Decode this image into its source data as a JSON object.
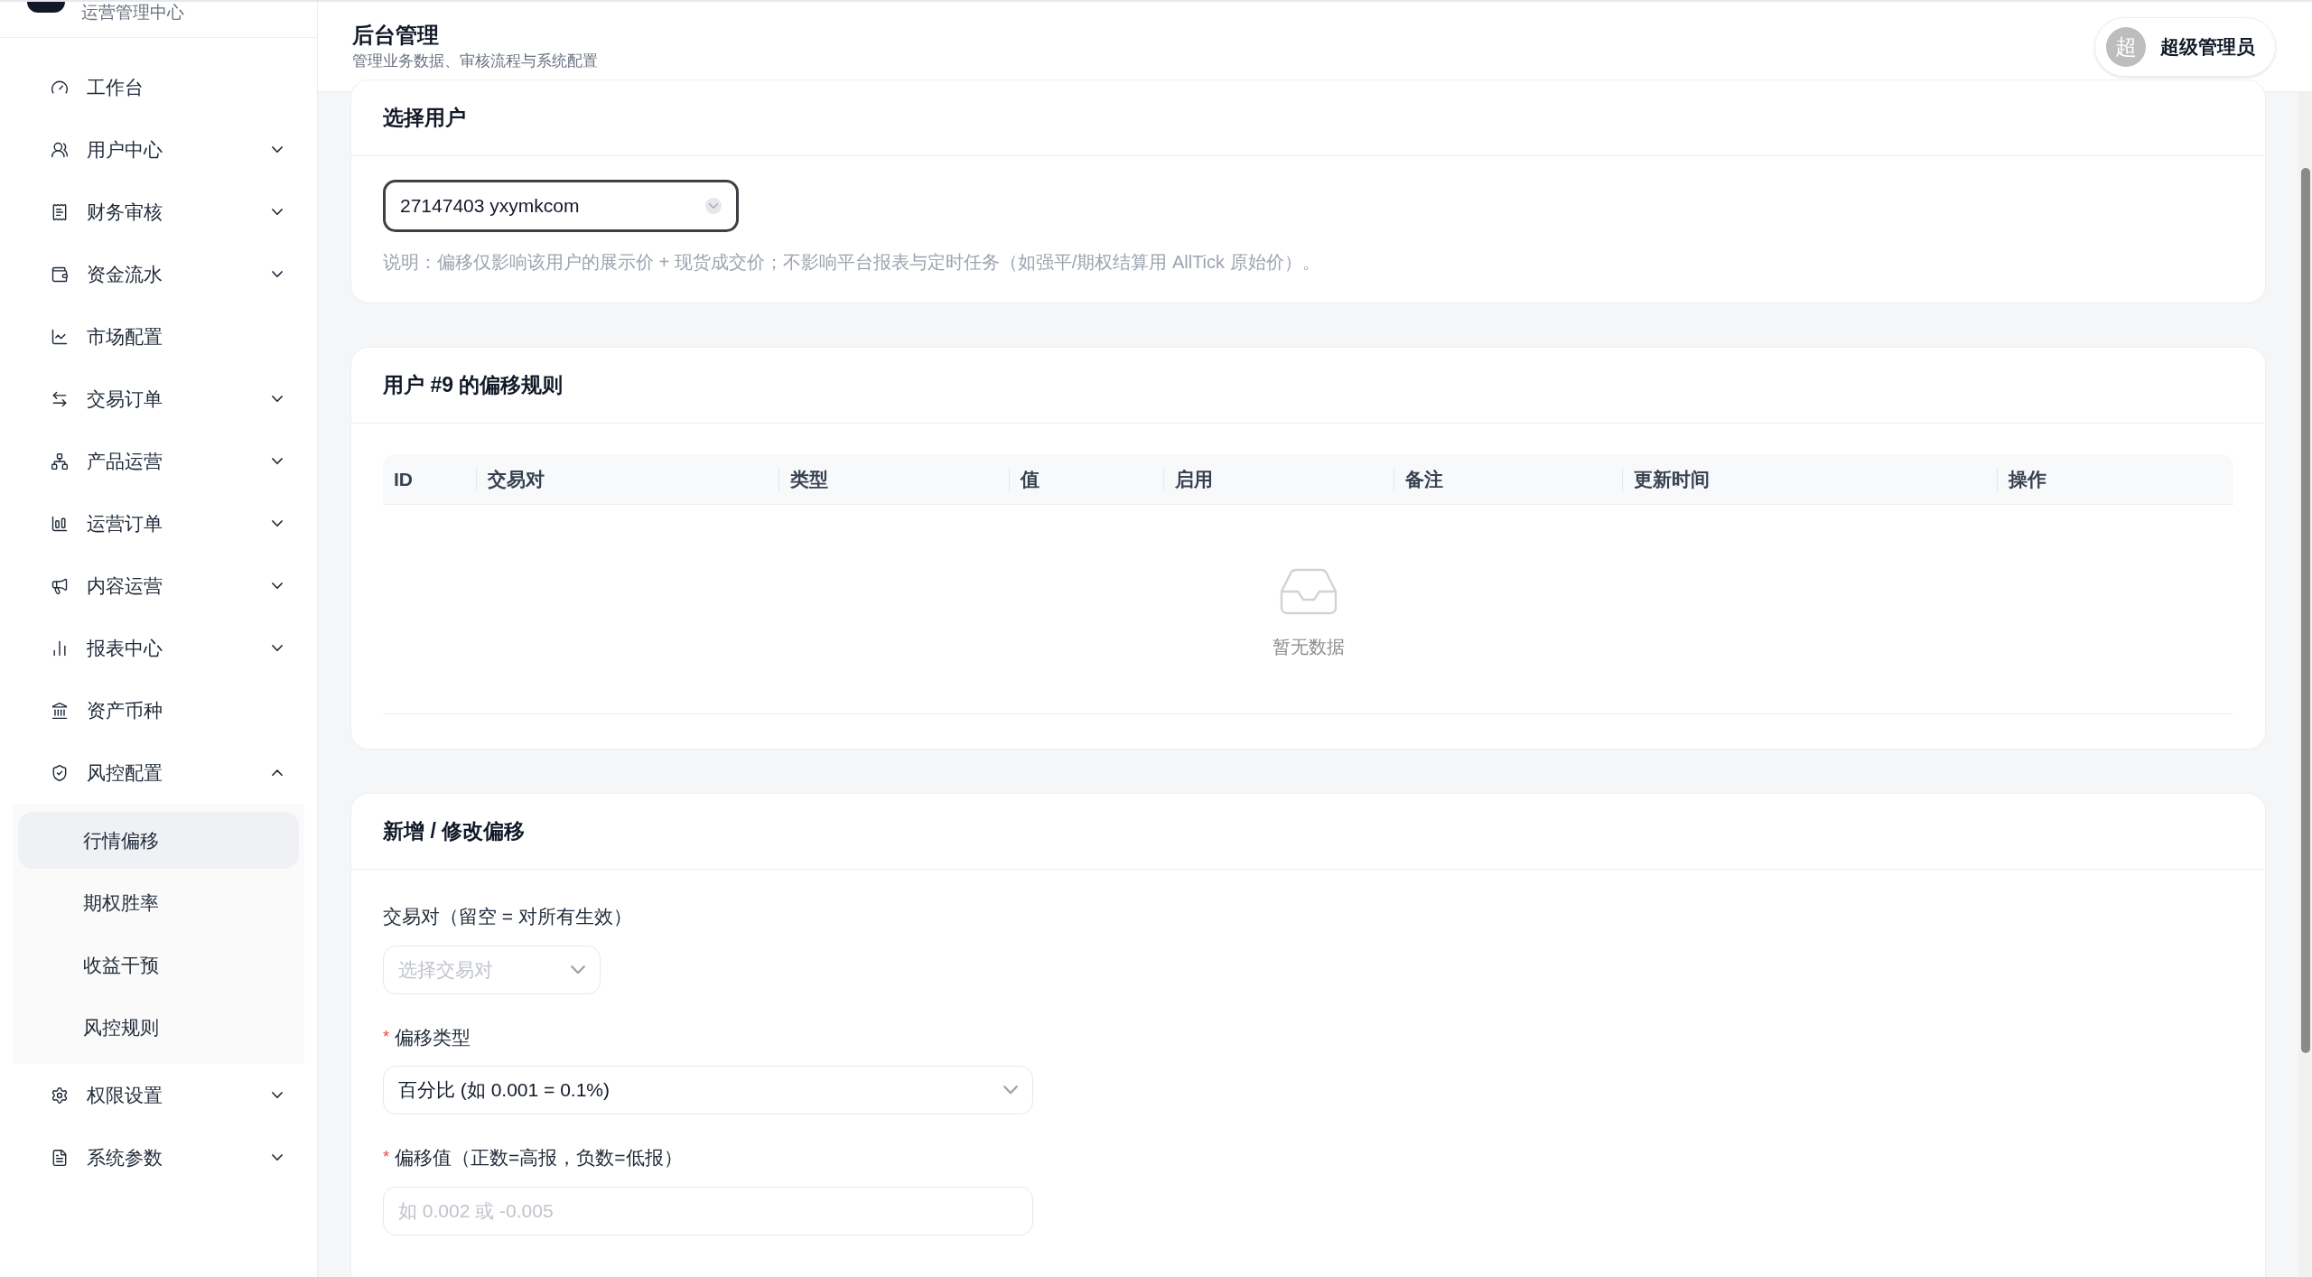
{
  "sidebar": {
    "subtitle": "运营管理中心",
    "items": [
      {
        "label": "工作台",
        "kind": "link"
      },
      {
        "label": "用户中心",
        "kind": "group",
        "expanded": false
      },
      {
        "label": "财务审核",
        "kind": "group",
        "expanded": false
      },
      {
        "label": "资金流水",
        "kind": "group",
        "expanded": false
      },
      {
        "label": "市场配置",
        "kind": "link"
      },
      {
        "label": "交易订单",
        "kind": "group",
        "expanded": false
      },
      {
        "label": "产品运营",
        "kind": "group",
        "expanded": false
      },
      {
        "label": "运营订单",
        "kind": "group",
        "expanded": false
      },
      {
        "label": "内容运营",
        "kind": "group",
        "expanded": false
      },
      {
        "label": "报表中心",
        "kind": "group",
        "expanded": false
      },
      {
        "label": "资产币种",
        "kind": "link"
      },
      {
        "label": "风控配置",
        "kind": "group",
        "expanded": true,
        "children": [
          {
            "label": "行情偏移",
            "selected": true
          },
          {
            "label": "期权胜率",
            "selected": false
          },
          {
            "label": "收益干预",
            "selected": false
          },
          {
            "label": "风控规则",
            "selected": false
          }
        ]
      },
      {
        "label": "权限设置",
        "kind": "group",
        "expanded": false
      },
      {
        "label": "系统参数",
        "kind": "group",
        "expanded": false
      }
    ]
  },
  "header": {
    "title": "后台管理",
    "subtitle": "管理业务数据、审核流程与系统配置",
    "user": {
      "avatar": "超",
      "name": "超级管理员"
    }
  },
  "user_card": {
    "title": "选择用户",
    "select_value": "27147403 yxymkcom",
    "note": "说明：偏移仅影响该用户的展示价 + 现货成交价；不影响平台报表与定时任务（如强平/期权结算用 AllTick 原始价）。"
  },
  "rules_card": {
    "title": "用户 #9 的偏移规则",
    "columns": [
      "ID",
      "交易对",
      "类型",
      "值",
      "启用",
      "备注",
      "更新时间",
      "操作"
    ],
    "empty_text": "暂无数据"
  },
  "form_card": {
    "title": "新增 / 修改偏移",
    "fields": [
      {
        "label": "交易对（留空 = 对所有生效）",
        "kind": "short-select",
        "placeholder": "选择交易对"
      },
      {
        "label": "偏移类型",
        "required_mark": "*",
        "kind": "select",
        "value": "百分比 (如 0.001 = 0.1%)"
      },
      {
        "label": "偏移值（正数=高报，负数=低报）",
        "required_mark": "*",
        "kind": "input",
        "placeholder": "如 0.002 或 -0.005"
      }
    ]
  }
}
